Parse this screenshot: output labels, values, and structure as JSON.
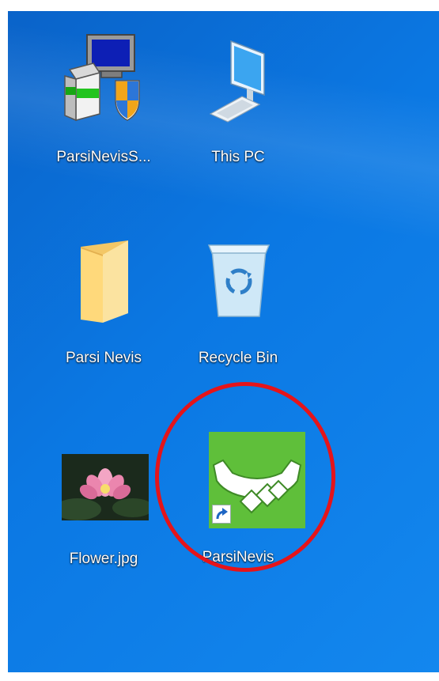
{
  "desktop": {
    "icons": [
      {
        "label": "ParsiNevisS...",
        "icon": "installer-icon"
      },
      {
        "label": "This PC",
        "icon": "computer-icon"
      },
      {
        "label": "Parsi Nevis",
        "icon": "folder-icon"
      },
      {
        "label": "Recycle Bin",
        "icon": "recycle-bin-icon"
      },
      {
        "label": "Flower.jpg",
        "icon": "image-thumbnail-icon"
      },
      {
        "label": "ParsiNevis",
        "icon": "parsinevis-shortcut-icon"
      }
    ]
  },
  "annotation": {
    "circle_color": "#e5141a"
  },
  "colors": {
    "desktop_background": "#0b78e3",
    "parsinevis_green": "#5fbf3a"
  }
}
